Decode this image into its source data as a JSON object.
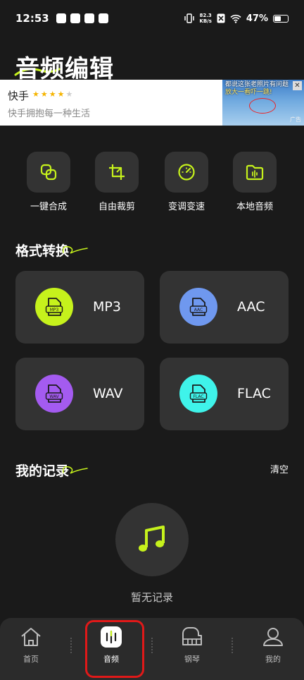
{
  "status_bar": {
    "time": "12:53",
    "net_speed_value": "82.3",
    "net_speed_unit": "KB/s",
    "battery": "47%"
  },
  "page": {
    "title": "音频编辑"
  },
  "ad": {
    "app_name": "快手",
    "slogan": "快手拥抱每一种生活",
    "image_text_line1": "都说这张老照片有问题",
    "image_text_line2": "放大一看吓一跳!",
    "tag": "广告",
    "rating_stars": 4
  },
  "tools": [
    {
      "label": "一键合成",
      "icon": "merge-icon"
    },
    {
      "label": "自由裁剪",
      "icon": "crop-icon"
    },
    {
      "label": "变调变速",
      "icon": "speed-gauge-icon"
    },
    {
      "label": "本地音频",
      "icon": "folder-audio-icon"
    }
  ],
  "format_section": {
    "title": "格式转换",
    "formats": [
      {
        "label": "MP3",
        "icon_text": "MP3",
        "color": "#c6f21c"
      },
      {
        "label": "AAC",
        "icon_text": "AAC",
        "color": "#6f98ef"
      },
      {
        "label": "WAV",
        "icon_text": "WAV",
        "color": "#a45bf0"
      },
      {
        "label": "FLAC",
        "icon_text": "FLAC",
        "color": "#3ff3ea"
      }
    ]
  },
  "records_section": {
    "title": "我的记录",
    "clear_label": "清空",
    "empty_text": "暂无记录"
  },
  "bottom_nav": {
    "items": [
      {
        "label": "首页",
        "icon": "home-icon"
      },
      {
        "label": "音频",
        "icon": "audio-icon"
      },
      {
        "label": "钢琴",
        "icon": "piano-icon"
      },
      {
        "label": "我的",
        "icon": "user-icon"
      }
    ],
    "active_index": 1
  },
  "colors": {
    "background": "#1a1a1a",
    "card": "#333333",
    "accent": "#c6f21c",
    "highlight": "#e01919"
  }
}
